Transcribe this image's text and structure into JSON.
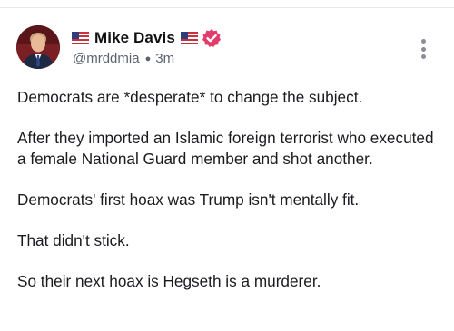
{
  "post": {
    "author": {
      "flag_before": "🇺🇸",
      "display_name": "Mike Davis",
      "flag_after": "🇺🇸",
      "handle": "@mrddmia",
      "time_ago": "3m",
      "verified": true,
      "verified_icon": "verified-badge-icon",
      "verified_color": "#e23c6b"
    },
    "paragraphs": [
      "Democrats are *desperate* to change the subject.",
      "After they imported an Islamic foreign terrorist who executed a female National Guard member and shot another.",
      "Democrats' first hoax was Trump isn't mentally fit.",
      "That didn't stick.",
      "So their next hoax is Hegseth is a murderer."
    ],
    "menu_icon": "more-options-icon"
  },
  "colors": {
    "text": "#1b1b1f",
    "secondary_text": "#5c6370",
    "divider": "#e9e9ec"
  }
}
